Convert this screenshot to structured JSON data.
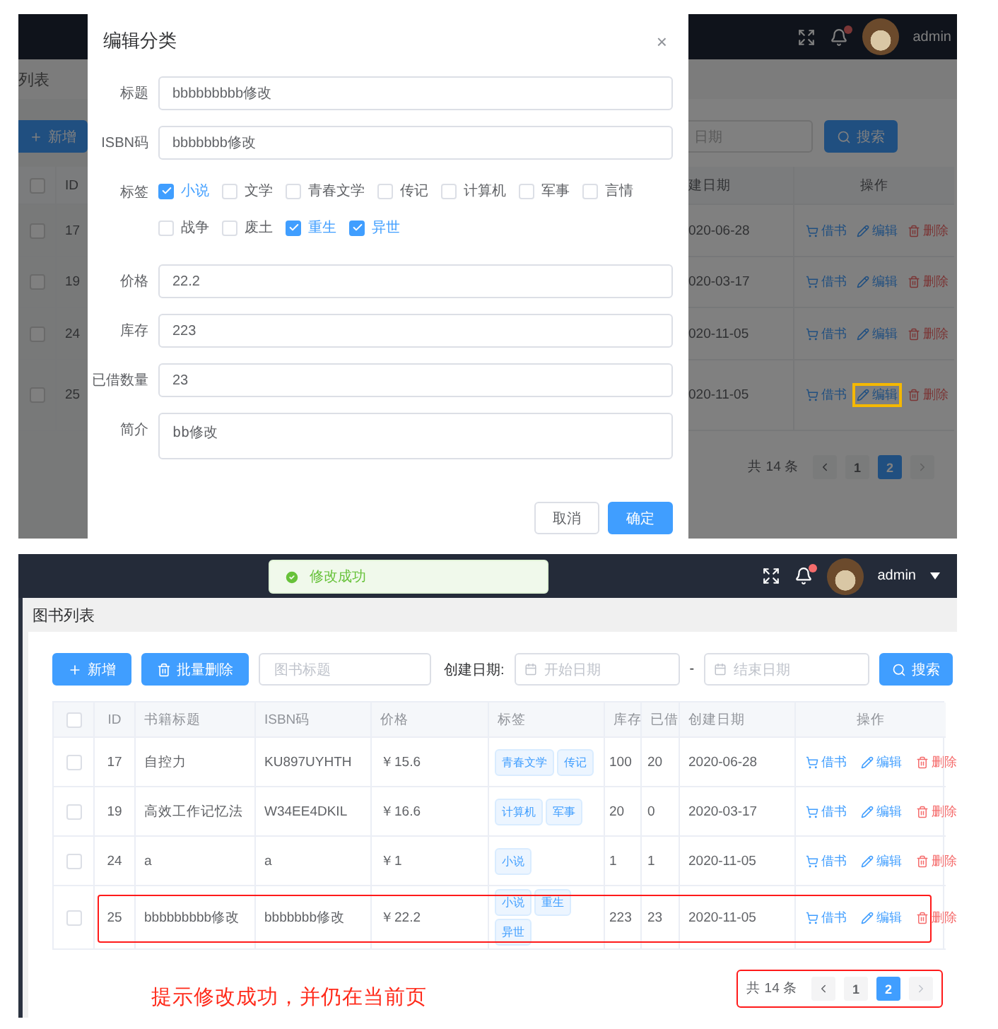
{
  "top_screen": {
    "header": {
      "user": "admin",
      "notification": true
    },
    "breadcrumb": "列表",
    "add_button": "新增",
    "date_placeholder": "日期",
    "search_button": "搜索",
    "left_column": "ID",
    "header_checked": false,
    "right_columns": [
      "建日期",
      "操作"
    ],
    "rows": [
      {
        "id": "17",
        "checked": false,
        "date": "020-06-28",
        "actions": [
          {
            "label": "借书",
            "kind": "borrow",
            "highlighted": false
          },
          {
            "label": "编辑",
            "kind": "edit",
            "highlighted": false
          },
          {
            "label": "删除",
            "kind": "delete",
            "highlighted": false
          }
        ]
      },
      {
        "id": "19",
        "checked": false,
        "date": "020-03-17",
        "actions": [
          {
            "label": "借书",
            "kind": "borrow",
            "highlighted": false
          },
          {
            "label": "编辑",
            "kind": "edit",
            "highlighted": false
          },
          {
            "label": "删除",
            "kind": "delete",
            "highlighted": false
          }
        ]
      },
      {
        "id": "24",
        "checked": false,
        "date": "020-11-05",
        "actions": [
          {
            "label": "借书",
            "kind": "borrow",
            "highlighted": false
          },
          {
            "label": "编辑",
            "kind": "edit",
            "highlighted": false
          },
          {
            "label": "删除",
            "kind": "delete",
            "highlighted": false
          }
        ]
      },
      {
        "id": "25",
        "checked": false,
        "date": "020-11-05",
        "actions": [
          {
            "label": "借书",
            "kind": "borrow",
            "highlighted": false
          },
          {
            "label": "编辑",
            "kind": "edit",
            "highlighted": true
          },
          {
            "label": "删除",
            "kind": "delete",
            "highlighted": false
          }
        ]
      }
    ],
    "pagination": {
      "total": "共 14 条",
      "pages": [
        {
          "label": "1",
          "selected": false
        },
        {
          "label": "2",
          "selected": true
        }
      ]
    },
    "dialog": {
      "title": "编辑分类",
      "close": "×",
      "fields": [
        {
          "label": "标题",
          "kind": "input",
          "value": "bbbbbbbbb修改"
        },
        {
          "label": "ISBN码",
          "kind": "input",
          "value": "bbbbbbb修改"
        },
        {
          "label": "标签",
          "kind": "tags",
          "options": [
            {
              "label": "小说",
              "checked": true
            },
            {
              "label": "文学",
              "checked": false
            },
            {
              "label": "青春文学",
              "checked": false
            },
            {
              "label": "传记",
              "checked": false
            },
            {
              "label": "计算机",
              "checked": false
            },
            {
              "label": "军事",
              "checked": false
            },
            {
              "label": "言情",
              "checked": false
            },
            {
              "label": "战争",
              "checked": false
            },
            {
              "label": "废土",
              "checked": false
            },
            {
              "label": "重生",
              "checked": true
            },
            {
              "label": "异世",
              "checked": true
            }
          ]
        },
        {
          "label": "价格",
          "kind": "input",
          "value": "22.2"
        },
        {
          "label": "库存",
          "kind": "input",
          "value": "223"
        },
        {
          "label": "已借数量",
          "kind": "input",
          "value": "23"
        },
        {
          "label": "简介",
          "kind": "textarea",
          "value": "bb修改"
        }
      ],
      "buttons": [
        {
          "label": "取消",
          "kind": "default"
        },
        {
          "label": "确定",
          "kind": "primary"
        }
      ]
    }
  },
  "bottom_screen": {
    "toast": "修改成功",
    "header": {
      "user": "admin",
      "notification": true
    },
    "breadcrumb": "图书列表",
    "toolbar": {
      "add_button": "新增",
      "batch_delete_button": "批量删除",
      "title_placeholder": "图书标题",
      "date_label": "创建日期:",
      "start_placeholder": "开始日期",
      "separator": "-",
      "end_placeholder": "结束日期",
      "search_button": "搜索"
    },
    "header_checked": false,
    "columns": [
      "ID",
      "书籍标题",
      "ISBN码",
      "价格",
      "标签",
      "库存",
      "已借",
      "创建日期",
      "操作"
    ],
    "rows": [
      {
        "checked": false,
        "annotated": false,
        "id": "17",
        "title": "自控力",
        "isbn": "KU897UYHTH",
        "price": "￥15.6",
        "tags": [
          "青春文学",
          "传记"
        ],
        "stock": "100",
        "borrowed": "20",
        "date": "2020-06-28",
        "actions": [
          {
            "label": "借书",
            "kind": "borrow"
          },
          {
            "label": "编辑",
            "kind": "edit"
          },
          {
            "label": "删除",
            "kind": "delete"
          }
        ]
      },
      {
        "checked": false,
        "annotated": false,
        "id": "19",
        "title": "高效工作记忆法",
        "isbn": "W34EE4DKIL",
        "price": "￥16.6",
        "tags": [
          "计算机",
          "军事"
        ],
        "stock": "20",
        "borrowed": "0",
        "date": "2020-03-17",
        "actions": [
          {
            "label": "借书",
            "kind": "borrow"
          },
          {
            "label": "编辑",
            "kind": "edit"
          },
          {
            "label": "删除",
            "kind": "delete"
          }
        ]
      },
      {
        "checked": false,
        "annotated": false,
        "id": "24",
        "title": "a",
        "isbn": "a",
        "price": "￥1",
        "tags": [
          "小说"
        ],
        "stock": "1",
        "borrowed": "1",
        "date": "2020-11-05",
        "actions": [
          {
            "label": "借书",
            "kind": "borrow"
          },
          {
            "label": "编辑",
            "kind": "edit"
          },
          {
            "label": "删除",
            "kind": "delete"
          }
        ]
      },
      {
        "checked": false,
        "annotated": true,
        "id": "25",
        "title": "bbbbbbbbb修改",
        "isbn": "bbbbbbb修改",
        "price": "￥22.2",
        "tags": [
          "小说",
          "重生",
          "异世"
        ],
        "stock": "223",
        "borrowed": "23",
        "date": "2020-11-05",
        "actions": [
          {
            "label": "借书",
            "kind": "borrow"
          },
          {
            "label": "编辑",
            "kind": "edit"
          },
          {
            "label": "删除",
            "kind": "delete"
          }
        ]
      }
    ],
    "pagination": {
      "annotated": true,
      "total": "共 14 条",
      "pages": [
        {
          "label": "1",
          "selected": false
        },
        {
          "label": "2",
          "selected": true
        }
      ]
    },
    "note": "提示修改成功，并仍在当前页"
  }
}
